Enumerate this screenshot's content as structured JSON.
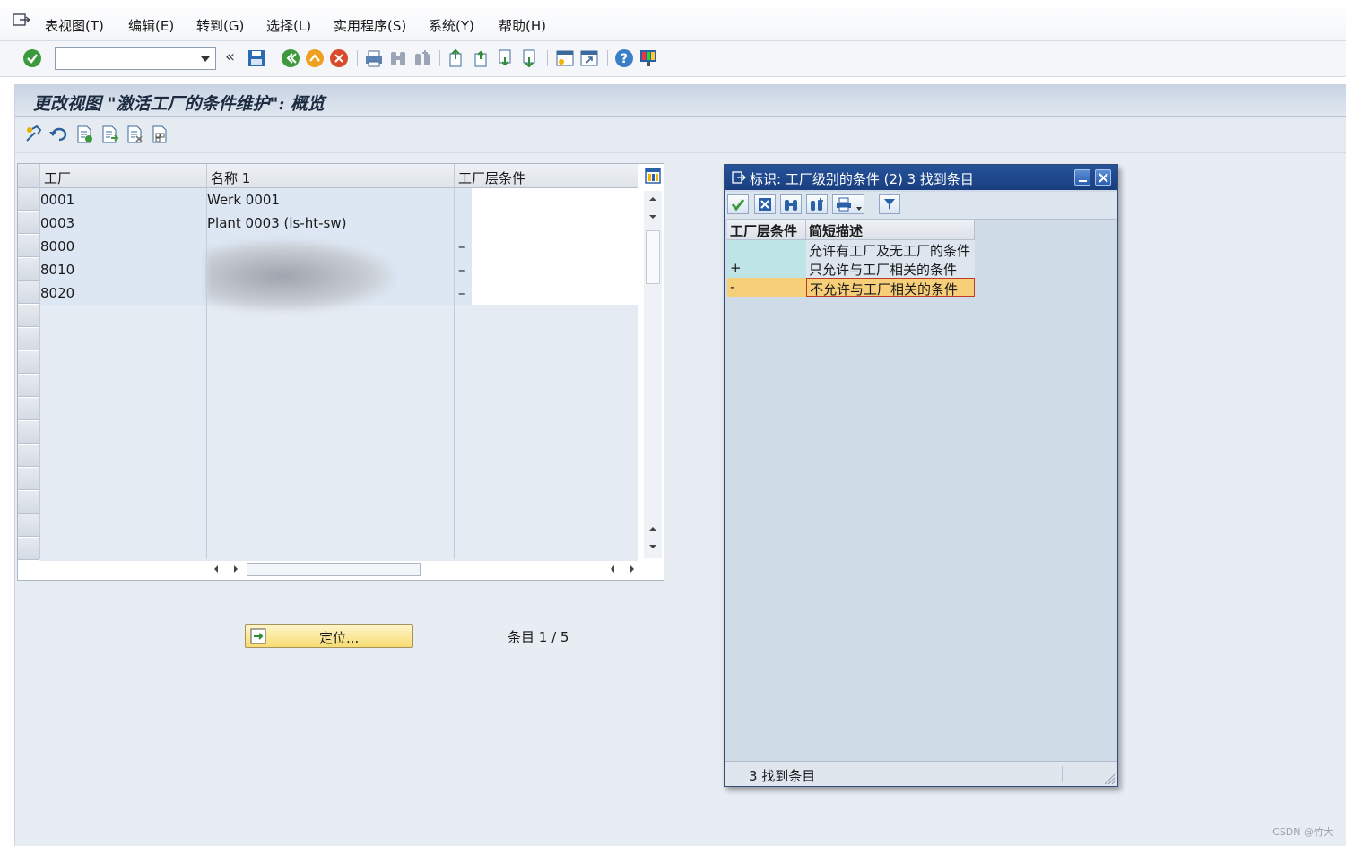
{
  "menubar": {
    "items": [
      "表视图(T)",
      "编辑(E)",
      "转到(G)",
      "选择(L)",
      "实用程序(S)",
      "系统(Y)",
      "帮助(H)"
    ]
  },
  "toolbar": {
    "command_field_value": ""
  },
  "page": {
    "title": "更改视图 \"激活工厂的条件维护\": 概览"
  },
  "table": {
    "columns": [
      "工厂",
      "名称 1",
      "工厂层条件"
    ],
    "rows": [
      {
        "plant": "0001",
        "name": "Werk 0001",
        "cond": ""
      },
      {
        "plant": "0003",
        "name": "Plant 0003 (is-ht-sw)",
        "cond": ""
      },
      {
        "plant": "8000",
        "name": "",
        "cond": "–"
      },
      {
        "plant": "8010",
        "name": "",
        "cond": "–"
      },
      {
        "plant": "8020",
        "name": "",
        "cond": "–"
      }
    ]
  },
  "locate_button": {
    "label": "定位..."
  },
  "entry_counter": "条目 1 / 5",
  "popup": {
    "title": "标识: 工厂级别的条件 (2)     3 找到条目",
    "columns": [
      "工厂层条件",
      "简短描述"
    ],
    "rows": [
      {
        "key": "",
        "desc": "允许有工厂及无工厂的条件",
        "selected": false
      },
      {
        "key": "+",
        "desc": "只允许与工厂相关的条件",
        "selected": false
      },
      {
        "key": "-",
        "desc": "不允许与工厂相关的条件",
        "selected": true
      }
    ],
    "status": "3 找到条目"
  },
  "watermark": "CSDN @竹大",
  "colors": {
    "accent": "#1b4a91",
    "selection": "#f7cf79",
    "key_cell": "#bfe4e6"
  }
}
